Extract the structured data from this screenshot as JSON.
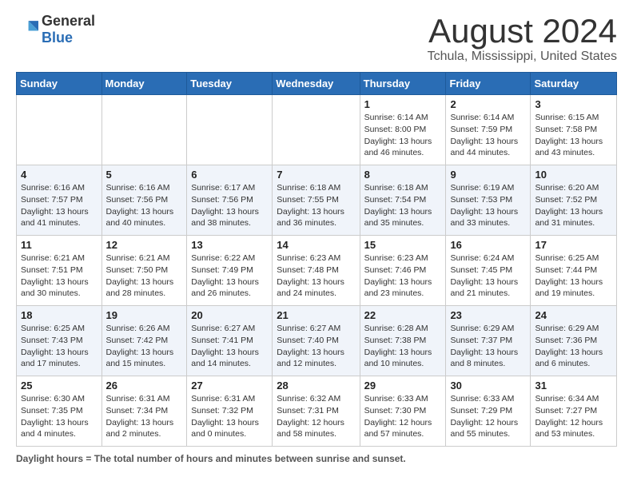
{
  "header": {
    "logo_general": "General",
    "logo_blue": "Blue",
    "title": "August 2024",
    "subtitle": "Tchula, Mississippi, United States"
  },
  "footer": {
    "label": "Daylight hours"
  },
  "columns": [
    "Sunday",
    "Monday",
    "Tuesday",
    "Wednesday",
    "Thursday",
    "Friday",
    "Saturday"
  ],
  "weeks": [
    {
      "days": [
        {
          "num": "",
          "info": ""
        },
        {
          "num": "",
          "info": ""
        },
        {
          "num": "",
          "info": ""
        },
        {
          "num": "",
          "info": ""
        },
        {
          "num": "1",
          "info": "Sunrise: 6:14 AM\nSunset: 8:00 PM\nDaylight: 13 hours\nand 46 minutes."
        },
        {
          "num": "2",
          "info": "Sunrise: 6:14 AM\nSunset: 7:59 PM\nDaylight: 13 hours\nand 44 minutes."
        },
        {
          "num": "3",
          "info": "Sunrise: 6:15 AM\nSunset: 7:58 PM\nDaylight: 13 hours\nand 43 minutes."
        }
      ]
    },
    {
      "days": [
        {
          "num": "4",
          "info": "Sunrise: 6:16 AM\nSunset: 7:57 PM\nDaylight: 13 hours\nand 41 minutes."
        },
        {
          "num": "5",
          "info": "Sunrise: 6:16 AM\nSunset: 7:56 PM\nDaylight: 13 hours\nand 40 minutes."
        },
        {
          "num": "6",
          "info": "Sunrise: 6:17 AM\nSunset: 7:56 PM\nDaylight: 13 hours\nand 38 minutes."
        },
        {
          "num": "7",
          "info": "Sunrise: 6:18 AM\nSunset: 7:55 PM\nDaylight: 13 hours\nand 36 minutes."
        },
        {
          "num": "8",
          "info": "Sunrise: 6:18 AM\nSunset: 7:54 PM\nDaylight: 13 hours\nand 35 minutes."
        },
        {
          "num": "9",
          "info": "Sunrise: 6:19 AM\nSunset: 7:53 PM\nDaylight: 13 hours\nand 33 minutes."
        },
        {
          "num": "10",
          "info": "Sunrise: 6:20 AM\nSunset: 7:52 PM\nDaylight: 13 hours\nand 31 minutes."
        }
      ]
    },
    {
      "days": [
        {
          "num": "11",
          "info": "Sunrise: 6:21 AM\nSunset: 7:51 PM\nDaylight: 13 hours\nand 30 minutes."
        },
        {
          "num": "12",
          "info": "Sunrise: 6:21 AM\nSunset: 7:50 PM\nDaylight: 13 hours\nand 28 minutes."
        },
        {
          "num": "13",
          "info": "Sunrise: 6:22 AM\nSunset: 7:49 PM\nDaylight: 13 hours\nand 26 minutes."
        },
        {
          "num": "14",
          "info": "Sunrise: 6:23 AM\nSunset: 7:48 PM\nDaylight: 13 hours\nand 24 minutes."
        },
        {
          "num": "15",
          "info": "Sunrise: 6:23 AM\nSunset: 7:46 PM\nDaylight: 13 hours\nand 23 minutes."
        },
        {
          "num": "16",
          "info": "Sunrise: 6:24 AM\nSunset: 7:45 PM\nDaylight: 13 hours\nand 21 minutes."
        },
        {
          "num": "17",
          "info": "Sunrise: 6:25 AM\nSunset: 7:44 PM\nDaylight: 13 hours\nand 19 minutes."
        }
      ]
    },
    {
      "days": [
        {
          "num": "18",
          "info": "Sunrise: 6:25 AM\nSunset: 7:43 PM\nDaylight: 13 hours\nand 17 minutes."
        },
        {
          "num": "19",
          "info": "Sunrise: 6:26 AM\nSunset: 7:42 PM\nDaylight: 13 hours\nand 15 minutes."
        },
        {
          "num": "20",
          "info": "Sunrise: 6:27 AM\nSunset: 7:41 PM\nDaylight: 13 hours\nand 14 minutes."
        },
        {
          "num": "21",
          "info": "Sunrise: 6:27 AM\nSunset: 7:40 PM\nDaylight: 13 hours\nand 12 minutes."
        },
        {
          "num": "22",
          "info": "Sunrise: 6:28 AM\nSunset: 7:38 PM\nDaylight: 13 hours\nand 10 minutes."
        },
        {
          "num": "23",
          "info": "Sunrise: 6:29 AM\nSunset: 7:37 PM\nDaylight: 13 hours\nand 8 minutes."
        },
        {
          "num": "24",
          "info": "Sunrise: 6:29 AM\nSunset: 7:36 PM\nDaylight: 13 hours\nand 6 minutes."
        }
      ]
    },
    {
      "days": [
        {
          "num": "25",
          "info": "Sunrise: 6:30 AM\nSunset: 7:35 PM\nDaylight: 13 hours\nand 4 minutes."
        },
        {
          "num": "26",
          "info": "Sunrise: 6:31 AM\nSunset: 7:34 PM\nDaylight: 13 hours\nand 2 minutes."
        },
        {
          "num": "27",
          "info": "Sunrise: 6:31 AM\nSunset: 7:32 PM\nDaylight: 13 hours\nand 0 minutes."
        },
        {
          "num": "28",
          "info": "Sunrise: 6:32 AM\nSunset: 7:31 PM\nDaylight: 12 hours\nand 58 minutes."
        },
        {
          "num": "29",
          "info": "Sunrise: 6:33 AM\nSunset: 7:30 PM\nDaylight: 12 hours\nand 57 minutes."
        },
        {
          "num": "30",
          "info": "Sunrise: 6:33 AM\nSunset: 7:29 PM\nDaylight: 12 hours\nand 55 minutes."
        },
        {
          "num": "31",
          "info": "Sunrise: 6:34 AM\nSunset: 7:27 PM\nDaylight: 12 hours\nand 53 minutes."
        }
      ]
    }
  ]
}
